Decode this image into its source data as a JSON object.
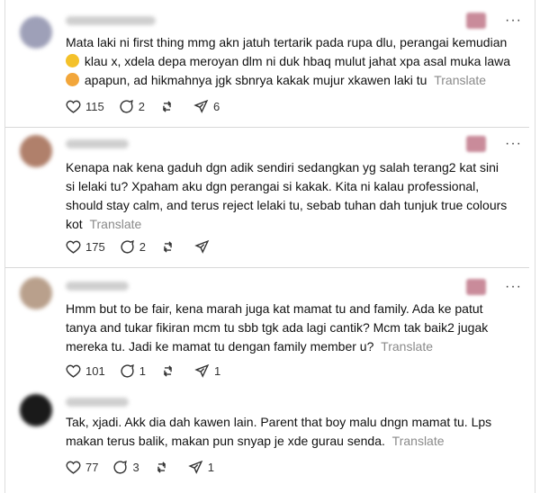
{
  "posts": [
    {
      "text_lines": [
        "Mata laki ni first thing mmg akn jatuh tertarik pada rupa dlu, perangai kemudian",
        "klau x, xdela depa meroyan dlm ni duk hbaq mulut jahat xpa asal muka lawa",
        "apapun, ad hikmahnya jgk sbnrya kakak mujur xkawen laki tu"
      ],
      "translate": "Translate",
      "likes": "115",
      "replies": "2",
      "reposts": "",
      "shares": "6"
    },
    {
      "text_lines": [
        "Kenapa nak kena gaduh dgn adik sendiri sedangkan yg salah terang2 kat sini",
        "si lelaki tu? Xpaham aku dgn perangai si kakak. Kita ni kalau professional,",
        "should stay calm, and terus reject lelaki tu, sebab tuhan dah tunjuk true colours",
        "kot"
      ],
      "translate": "Translate",
      "likes": "175",
      "replies": "2",
      "reposts": "",
      "shares": ""
    },
    {
      "text_lines": [
        "Hmm but to be fair, kena marah juga kat mamat tu and family. Ada ke patut",
        "tanya and tukar fikiran mcm tu sbb tgk ada lagi cantik? Mcm tak baik2 jugak",
        "mereka tu. Jadi ke mamat tu dengan family member u?"
      ],
      "translate": "Translate",
      "likes": "101",
      "replies": "1",
      "reposts": "",
      "shares": "1"
    },
    {
      "text_lines": [
        "Tak, xjadi. Akk dia dah kawen lain. Parent that boy malu dngn mamat tu. Lps",
        "makan terus balik, makan pun snyap je xde gurau senda."
      ],
      "translate": "Translate",
      "likes": "77",
      "replies": "3",
      "reposts": "",
      "shares": "1"
    }
  ],
  "more_label": "···",
  "icons": [
    "heart-icon",
    "reply-icon",
    "repost-icon",
    "share-icon",
    "more-icon"
  ],
  "colors": {
    "translate": "#8a8a8a",
    "divider": "#d9d9d9"
  }
}
